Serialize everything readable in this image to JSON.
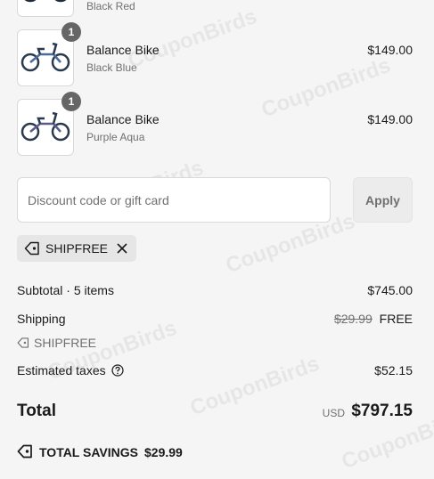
{
  "items": [
    {
      "title": "",
      "variant": "Black Red",
      "price": "",
      "qty": ""
    },
    {
      "title": "Balance Bike",
      "variant": "Black Blue",
      "price": "$149.00",
      "qty": "1"
    },
    {
      "title": "Balance Bike",
      "variant": "Purple Aqua",
      "price": "$149.00",
      "qty": "1"
    }
  ],
  "discount": {
    "placeholder": "Discount code or gift card",
    "apply_label": "Apply",
    "applied_code": "SHIPFREE"
  },
  "summary": {
    "subtotal_label": "Subtotal · 5 items",
    "subtotal_value": "$745.00",
    "shipping_label": "Shipping",
    "shipping_original": "$29.99",
    "shipping_value": "FREE",
    "shipping_discount_code": "SHIPFREE",
    "taxes_label": "Estimated taxes",
    "taxes_value": "$52.15",
    "total_label": "Total",
    "currency": "USD",
    "total_value": "$797.15",
    "savings_label": "TOTAL SAVINGS",
    "savings_value": "$29.99"
  },
  "watermark": "CouponBirds",
  "icons": [
    "tag-icon",
    "close-icon",
    "help-icon",
    "savings-tag-icon",
    "bike-thumbnail"
  ],
  "colors": {
    "background": "#f5f5f5",
    "badge": "#666666",
    "muted": "#707070"
  }
}
